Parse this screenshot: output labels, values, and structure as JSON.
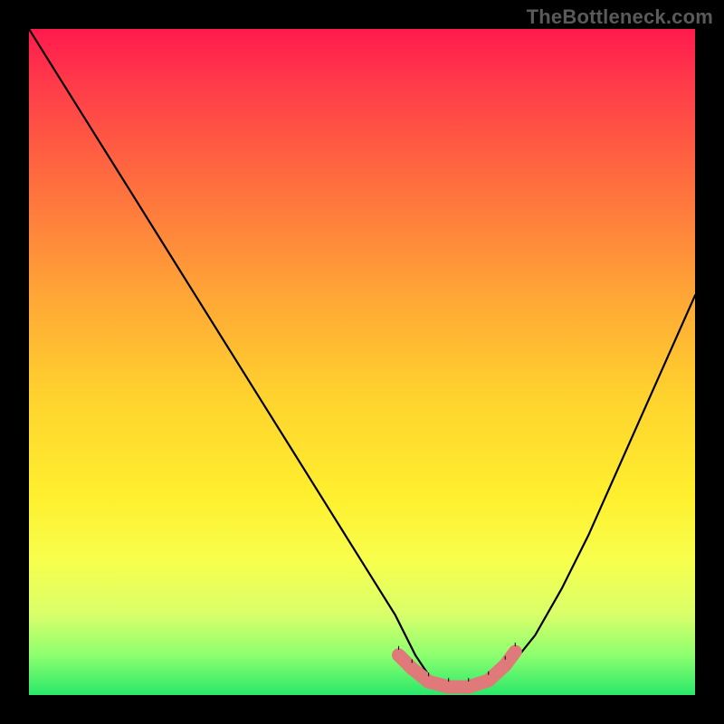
{
  "watermark": "TheBottleneck.com",
  "chart_data": {
    "type": "line",
    "title": "",
    "xlabel": "",
    "ylabel": "",
    "xlim": [
      0,
      100
    ],
    "ylim": [
      0,
      100
    ],
    "grid": false,
    "legend": false,
    "series": [
      {
        "name": "curve",
        "x": [
          0,
          5,
          10,
          15,
          20,
          25,
          30,
          35,
          40,
          45,
          50,
          55,
          58,
          60,
          62,
          64,
          66,
          68,
          72,
          76,
          80,
          84,
          88,
          92,
          96,
          100
        ],
        "y": [
          100,
          92,
          84,
          76,
          68,
          60,
          52,
          44,
          36,
          28,
          20,
          12,
          6,
          3,
          1.5,
          1,
          1,
          1.5,
          4,
          9,
          16,
          24,
          33,
          42,
          51,
          60
        ]
      }
    ],
    "markers": [
      {
        "name": "valley-segment",
        "shape": "rounded",
        "color": "#e07a7a",
        "points": [
          {
            "x": 55.5,
            "y": 6.0
          },
          {
            "x": 57.5,
            "y": 4.0
          },
          {
            "x": 60.0,
            "y": 2.0
          },
          {
            "x": 63.0,
            "y": 1.2
          },
          {
            "x": 66.0,
            "y": 1.2
          },
          {
            "x": 69.0,
            "y": 2.2
          },
          {
            "x": 71.5,
            "y": 4.5
          },
          {
            "x": 73.0,
            "y": 6.5
          }
        ]
      }
    ],
    "background_gradient": {
      "stops": [
        {
          "pos": 0,
          "color": "#ff1a4d"
        },
        {
          "pos": 22,
          "color": "#ff6a3f"
        },
        {
          "pos": 55,
          "color": "#ffd22e"
        },
        {
          "pos": 80,
          "color": "#f7ff4d"
        },
        {
          "pos": 100,
          "color": "#29e86a"
        }
      ]
    }
  }
}
